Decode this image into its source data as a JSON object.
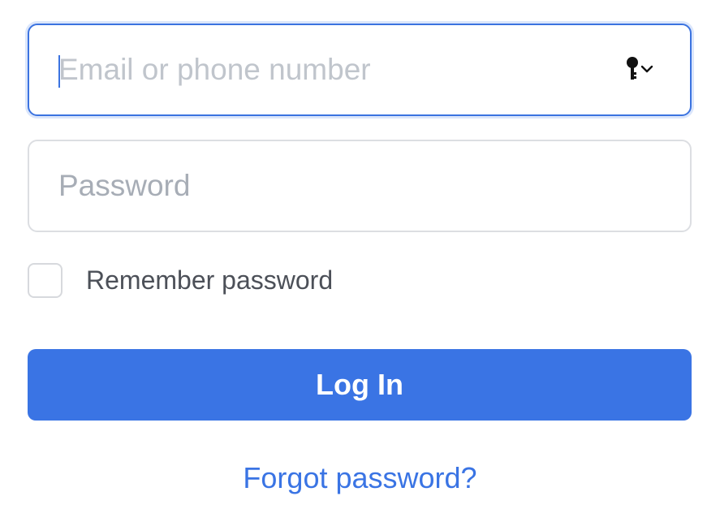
{
  "form": {
    "email_field": {
      "value": "",
      "placeholder": "Email or phone number"
    },
    "password_field": {
      "value": "",
      "placeholder": "Password"
    },
    "remember": {
      "label": "Remember password",
      "checked": false
    },
    "login_button_label": "Log In",
    "forgot_link_label": "Forgot password?"
  },
  "icons": {
    "password_manager": "key-icon",
    "dropdown": "chevron-down-icon"
  },
  "colors": {
    "accent": "#3a74e4",
    "focus_border": "#3b73e0",
    "placeholder": "#a7adb6",
    "label_text": "#4c5058"
  }
}
